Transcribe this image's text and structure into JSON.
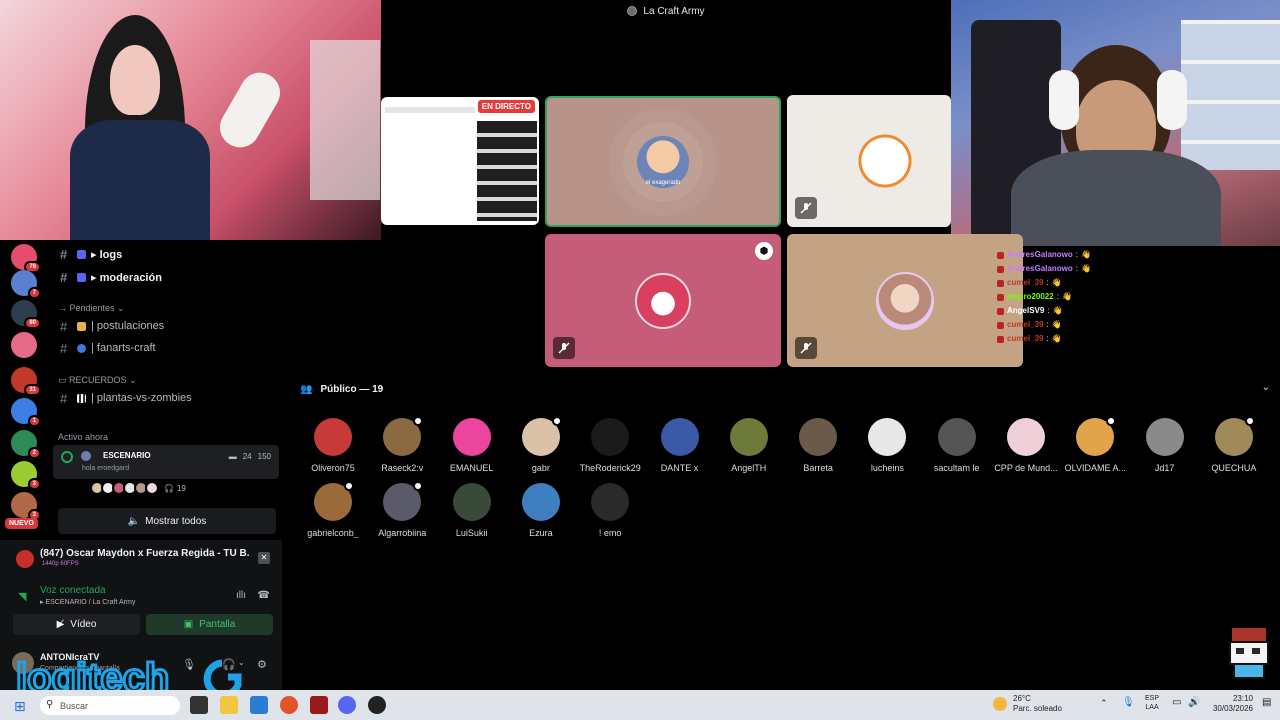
{
  "title_bar": {
    "server_name": "La Craft Army"
  },
  "stream_tile": {
    "live_label": "EN DIRECTO"
  },
  "main_tile": {
    "speaker_nametag": "el exagerado"
  },
  "chat_overlay": [
    {
      "user": "AndresGalanowo",
      "color": "#c77dff",
      "msg": ":"
    },
    {
      "user": "AndresGalanowo",
      "color": "#c77dff",
      "msg": ":"
    },
    {
      "user": "cumel_39",
      "color": "#c0392b",
      "msg": ":"
    },
    {
      "user": "jospro20022",
      "color": "#7cfc00",
      "msg": ":"
    },
    {
      "user": "AngelSV9",
      "color": "#ffffff",
      "msg": ":"
    },
    {
      "user": "cumel_39",
      "color": "#c0392b",
      "msg": ":"
    },
    {
      "user": "cumel_39",
      "color": "#c0392b",
      "msg": ":"
    }
  ],
  "guilds": [
    {
      "color": "#e74c6c",
      "count": "76"
    },
    {
      "color": "#5b7fd1",
      "count": "7"
    },
    {
      "color": "#2c3e50",
      "count": "80"
    },
    {
      "color": "#e86a8a",
      "count": ""
    },
    {
      "color": "#c0392b",
      "count": "31"
    },
    {
      "color": "#3d7ee6",
      "count": "1"
    },
    {
      "color": "#2e8b57",
      "count": "2"
    },
    {
      "color": "#9acd32",
      "count": "3"
    },
    {
      "color": "#b06a48",
      "count": "3"
    }
  ],
  "new_badge": "NUEVO",
  "channels": {
    "logs": "▸ logs",
    "moderacion": "▸ moderación",
    "pending_category": "→ Pendientes ⌄",
    "postulaciones": "| postulaciones",
    "fanarts": "| fanarts-craft",
    "memories_category": "RECUERDOS ⌄",
    "plants": "| plantas-vs-zombies",
    "active_now": "Activo ahora"
  },
  "stage": {
    "title": "ESCENARIO",
    "topic": "hola eroedgard",
    "cams": "24",
    "listeners": "150",
    "avatar_count": "19",
    "show_all": "Mostrar todos"
  },
  "now_playing": {
    "title": "(847) Oscar Maydon x Fuerza Regida - TU B...",
    "quality": "1440p 60FPS"
  },
  "voice": {
    "connected": "Voz conectada",
    "location": "▸ ESCENARIO / La Craft Army",
    "video_label": "Vídeo",
    "screen_label": "Pantalla"
  },
  "user": {
    "name": "ANTONIcraTV",
    "status": "Compartiendo su pantalla"
  },
  "audience": {
    "title": "Público — 19",
    "members": [
      {
        "name": "Oliveron75",
        "color": "#c73a3a",
        "dot": false
      },
      {
        "name": "Raseck2:v",
        "color": "#8a6a40",
        "dot": true
      },
      {
        "name": "EMANUEL",
        "color": "#eb459e",
        "dot": false
      },
      {
        "name": "gabr",
        "color": "#d9c2a8",
        "dot": true
      },
      {
        "name": "TheRoderick29",
        "color": "#1b1b1b",
        "dot": false
      },
      {
        "name": "DANTE x",
        "color": "#3a5aa8",
        "dot": false
      },
      {
        "name": "AngelTH",
        "color": "#6d7a3a",
        "dot": false
      },
      {
        "name": "Barreta",
        "color": "#6b5a4a",
        "dot": false
      },
      {
        "name": "lucheins",
        "color": "#e8e8e8",
        "dot": false
      },
      {
        "name": "sacultam le",
        "color": "#555555",
        "dot": false
      },
      {
        "name": "CPP de Mund...",
        "color": "#f0d0d8",
        "dot": false
      },
      {
        "name": "OLVIDAME A...",
        "color": "#e2a44a",
        "dot": true
      },
      {
        "name": "Jd17",
        "color": "#8a8a8a",
        "dot": false
      },
      {
        "name": "QUECHUA",
        "color": "#a08a5a",
        "dot": true
      },
      {
        "name": "gabrielconb_",
        "color": "#9a6a3a",
        "dot": true
      },
      {
        "name": "Algarrobiina",
        "color": "#5a5a6a",
        "dot": true
      },
      {
        "name": "LuiSukii",
        "color": "#3a4a3a",
        "dot": false
      },
      {
        "name": "Ezura",
        "color": "#3f7fc0",
        "dot": false
      },
      {
        "name": "! emo",
        "color": "#2a2a2a",
        "dot": false
      }
    ]
  },
  "watermark": "logitech",
  "taskbar": {
    "search_placeholder": "Buscar",
    "weather_temp": "26°C",
    "weather_desc": "Parc. soleado",
    "lang_1": "ESP",
    "lang_2": "LAA",
    "time": "23:10",
    "date": "30/03/2026"
  }
}
